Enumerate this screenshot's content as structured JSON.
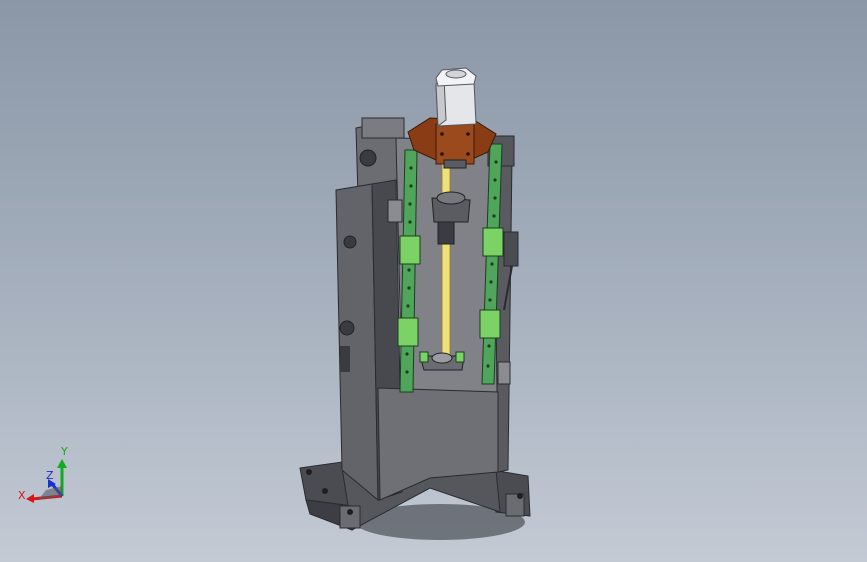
{
  "viewport": {
    "background_top": "#8b97a7",
    "background_bottom": "#c3cad4"
  },
  "model": {
    "body_color": "#5a5c62",
    "rail_color": "#4fa55a",
    "carriage_color": "#7ad364",
    "motor_mount_color": "#8a3c14",
    "motor_color": "#e4e6ea",
    "ball_screw_color": "#efe07c"
  },
  "triad": {
    "x_label": "X",
    "y_label": "Y",
    "z_label": "Z",
    "x_color": "#d81414",
    "y_color": "#11aa22",
    "z_color": "#1a2fd0"
  }
}
